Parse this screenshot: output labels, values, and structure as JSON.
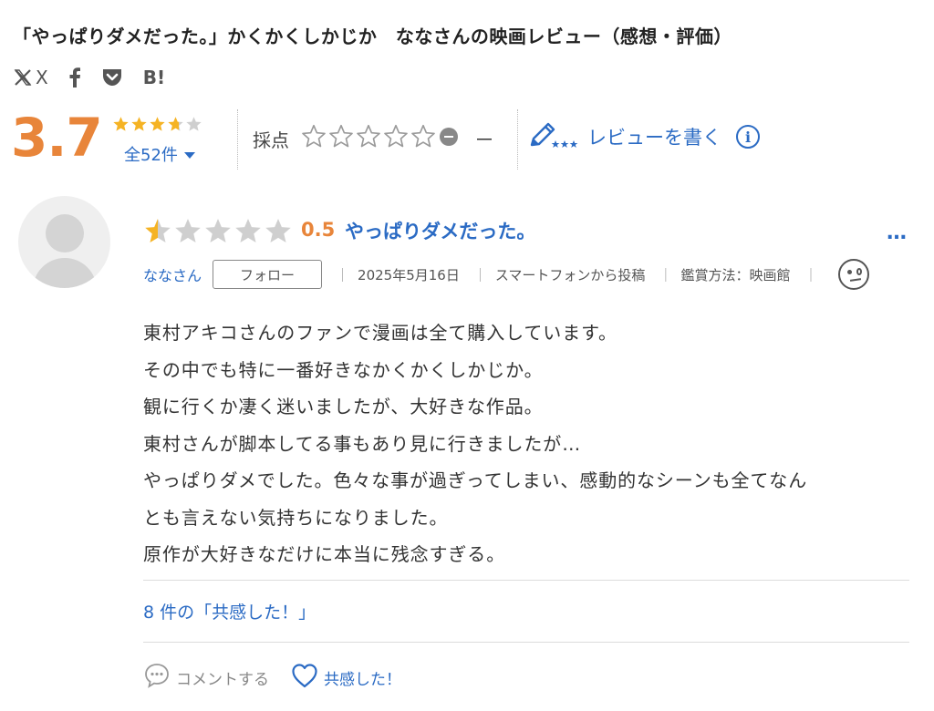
{
  "page": {
    "title": "「やっぱりダメだった。」かくかくしかじか　ななさんの映画レビュー（感想・評価）"
  },
  "share": {
    "x_label": "X",
    "hatena_label": "B!"
  },
  "rating_summary": {
    "average": "3.7",
    "average_value": 3.7,
    "review_count": "全52件",
    "score_label": "採点",
    "score_value": "－",
    "write_review_label": "レビューを書く",
    "info_label": "i"
  },
  "review": {
    "rating_value": 0.5,
    "score": "0.5",
    "title": "やっぱりダメだった。",
    "more_label": "…",
    "user_name": "ななさん",
    "follow_label": "フォロー",
    "separator": "｜",
    "date": "2025年5月16日",
    "device": "スマートフォンから投稿",
    "watch_method": "鑑賞方法：映画館",
    "body_lines": [
      "東村アキコさんのファンで漫画は全て購入しています。",
      "その中でも特に一番好きなかくかくしかじか。",
      "観に行くか凄く迷いましたが、大好きな作品。",
      "東村さんが脚本してる事もあり見に行きましたが…",
      "やっぱりダメでした。色々な事が過ぎってしまい、感動的なシーンも全てなん",
      "とも言えない気持ちになりました。",
      "原作が大好きなだけに本当に残念すぎる。"
    ],
    "empathy_count_text": "8 件の「共感した！」",
    "comment_label": "コメントする",
    "like_label": "共感した！"
  },
  "colors": {
    "accent_orange": "#e8853a",
    "link_blue": "#2b6bc4",
    "star_yellow": "#f5b324",
    "star_grey": "#cfcfcf"
  },
  "icons": {
    "share": [
      "x-logo-icon",
      "facebook-icon",
      "pocket-icon",
      "hatena-bookmark-icon"
    ],
    "write_review": "pencil-stars-icon",
    "info": "info-circle-icon",
    "mood": "mood-face-icon",
    "comment": "comment-bubble-icon",
    "like": "heart-icon"
  }
}
